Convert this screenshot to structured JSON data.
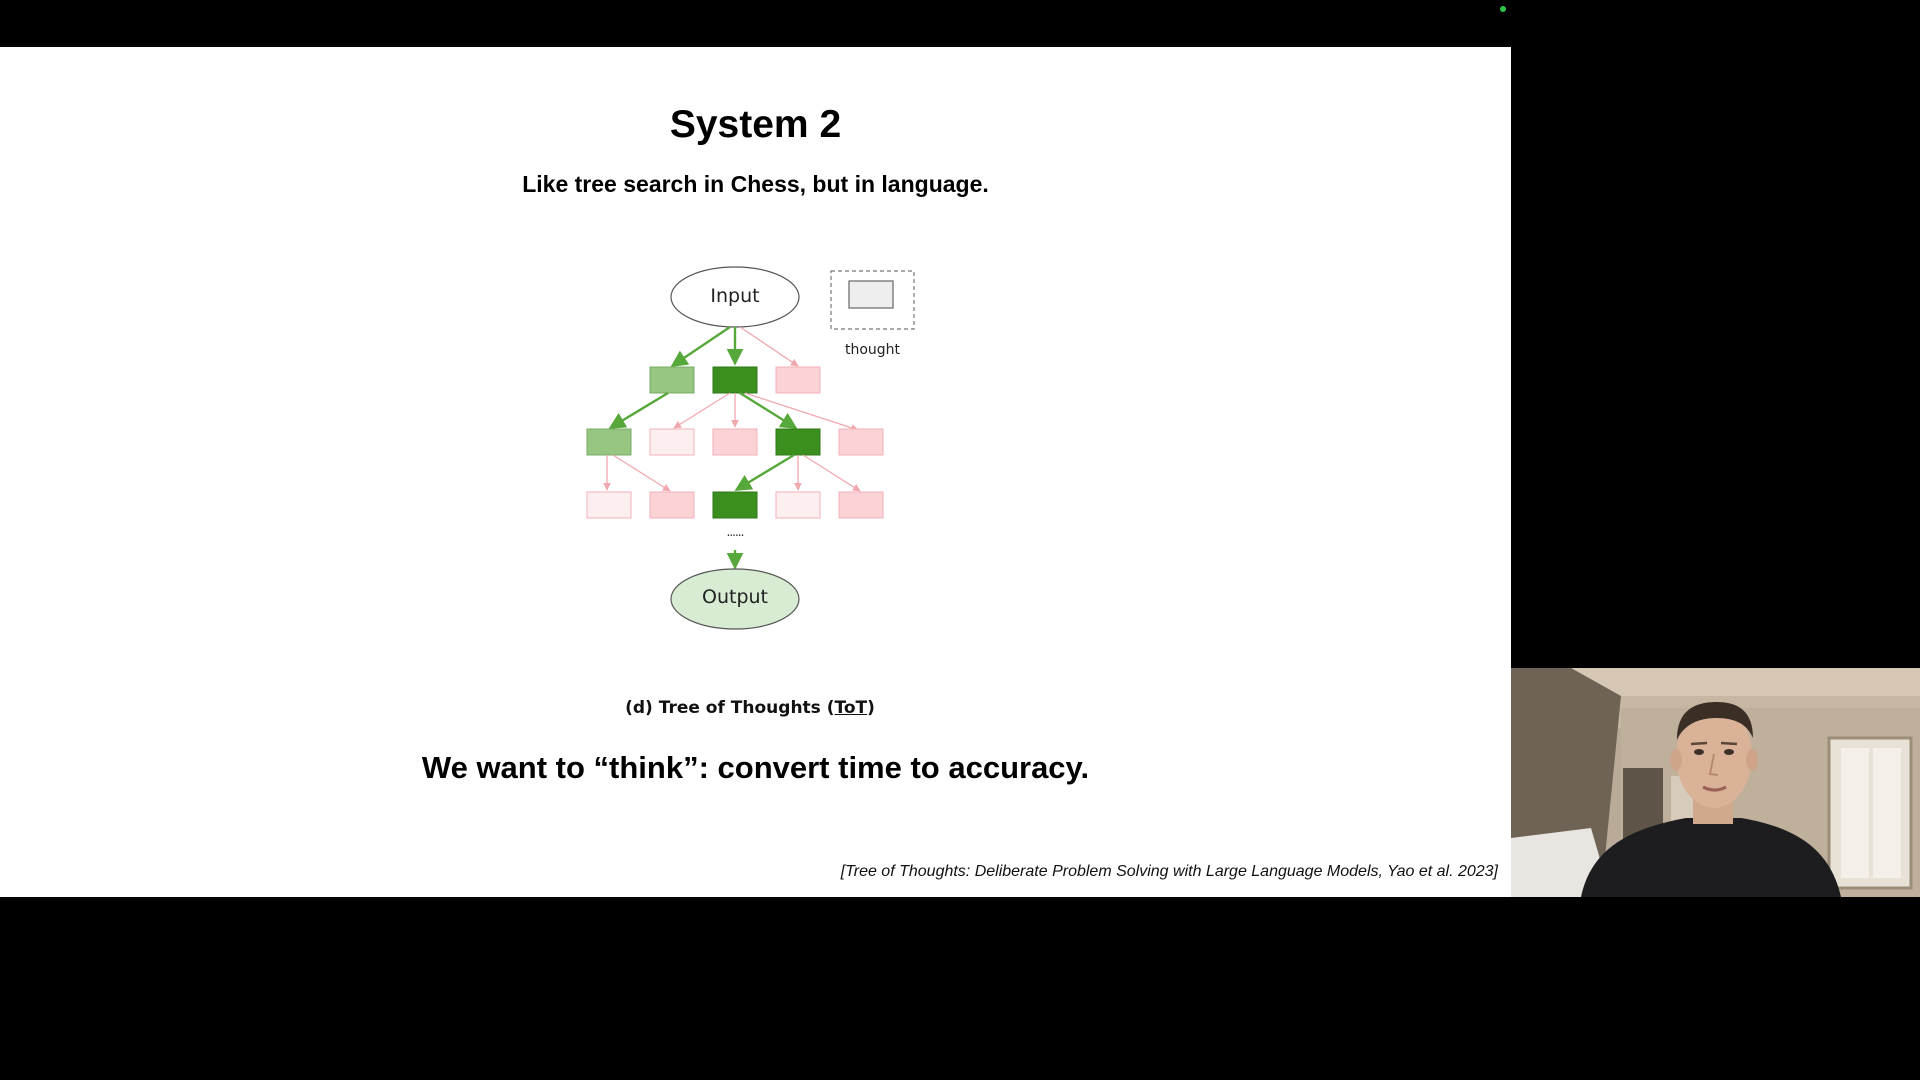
{
  "slide": {
    "title": "System 2",
    "subtitle": "Like tree search in Chess, but in language.",
    "tagline": "We want to “think”: convert time to accuracy.",
    "citation": "[Tree of Thoughts: Deliberate Problem Solving with Large Language Models, Yao et al. 2023]"
  },
  "diagram": {
    "input_label": "Input",
    "output_label": "Output",
    "legend_label": "thought",
    "ellipsis": "......",
    "caption_prefix": "(d) Tree of Thoughts (",
    "caption_link": "ToT",
    "caption_suffix": ")",
    "colors": {
      "strong_green": "#3a8f1e",
      "light_green": "#97c682",
      "pink": "#fbd3d6",
      "pale_pink": "#fdeef0",
      "green_arrow": "#56a83a",
      "pink_arrow": "#f0a8ae",
      "output_fill": "#d8ebd3"
    }
  },
  "webcam": {
    "description_icon": "presenter-video"
  }
}
